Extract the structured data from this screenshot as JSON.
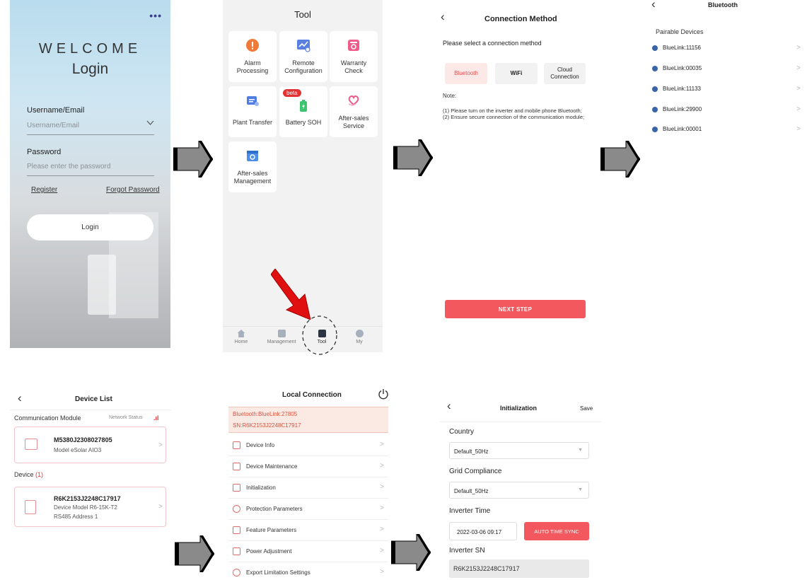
{
  "login": {
    "menu_dots": "•••",
    "welcome": "WELCOME",
    "title": "Login",
    "username_label": "Username/Email",
    "username_placeholder": "Username/Email",
    "password_label": "Password",
    "password_placeholder": "Please enter the password",
    "register": "Register",
    "forgot": "Forgot Password",
    "button": "Login"
  },
  "tool": {
    "title": "Tool",
    "tiles": [
      {
        "label": "Alarm\nProcessing",
        "icon": "alarm-icon",
        "color": "#f07a3a"
      },
      {
        "label": "Remote\nConfiguration",
        "icon": "remote-config-icon",
        "color": "#5a7fe0"
      },
      {
        "label": "Warranty\nCheck",
        "icon": "warranty-icon",
        "color": "#ef5c8a"
      },
      {
        "label": "Plant Transfer",
        "icon": "plant-transfer-icon",
        "color": "#4f7de3"
      },
      {
        "label": "Battery SOH",
        "icon": "battery-icon",
        "color": "#3cc46e",
        "badge": "beta"
      },
      {
        "label": "After-sales\nService",
        "icon": "heart-hand-icon",
        "color": "#ef5c8a"
      },
      {
        "label": "After-sales\nManagement",
        "icon": "management-icon",
        "color": "#4f8fe3"
      }
    ],
    "tabs": [
      {
        "label": "Home",
        "icon": "home-icon"
      },
      {
        "label": "Management",
        "icon": "management-tab-icon"
      },
      {
        "label": "Tool",
        "icon": "tool-tab-icon"
      },
      {
        "label": "My",
        "icon": "profile-icon"
      }
    ]
  },
  "connection": {
    "back": "‹",
    "title": "Connection Method",
    "prompt": "Please select a connection method",
    "options": [
      "Bluetooth",
      "WiFi",
      "Cloud\nConnection"
    ],
    "note_label": "Note:",
    "note_lines": [
      "(1) Please turn on the inverter and mobile phone Bluetooth;",
      "(2) Ensure secure connection of the communication module;"
    ],
    "next": "NEXT STEP"
  },
  "bluetooth": {
    "back": "‹",
    "title": "Bluetooth",
    "section": "Pairable Devices",
    "devices": [
      "BlueLink:11156",
      "BlueLink:00035",
      "BlueLink:11133",
      "BlueLink:29900",
      "BlueLink:00001"
    ]
  },
  "device_list": {
    "back": "‹",
    "title": "Device List",
    "module_label": "Communication Module",
    "network_status": "Network Status",
    "module": {
      "sn": "M5380J2308027805",
      "model": "Model  eSolar AIO3"
    },
    "device_label": "Device",
    "device_count": "(1)",
    "device": {
      "sn": "R6K2153J2248C17917",
      "model": "Device Model  R6-15K-T2",
      "address": "RS485 Address  1"
    }
  },
  "local": {
    "title": "Local Connection",
    "bt": "Bluetooth:BlueLink:27805",
    "sn": "SN:R6K2153J2248C17917",
    "menu": [
      "Device Info",
      "Device Maintenance",
      "Initialization",
      "Protection Parameters",
      "Feature Parameters",
      "Power Adjustment",
      "Export Limitation Settings"
    ]
  },
  "init": {
    "back": "‹",
    "title": "Initialization",
    "save": "Save",
    "country_label": "Country",
    "country_value": "Default_50Hz",
    "grid_label": "Grid Compliance",
    "grid_value": "Default_50Hz",
    "time_label": "Inverter Time",
    "time_value": "2022-03-06 09:17",
    "sync": "AUTO TIME SYNC",
    "sn_label": "Inverter SN",
    "sn_value": "R6K2153J2248C17917"
  },
  "colors": {
    "accent": "#f2585d",
    "arrow_fill": "#8a8a8a",
    "red_arrow": "#e01010"
  }
}
